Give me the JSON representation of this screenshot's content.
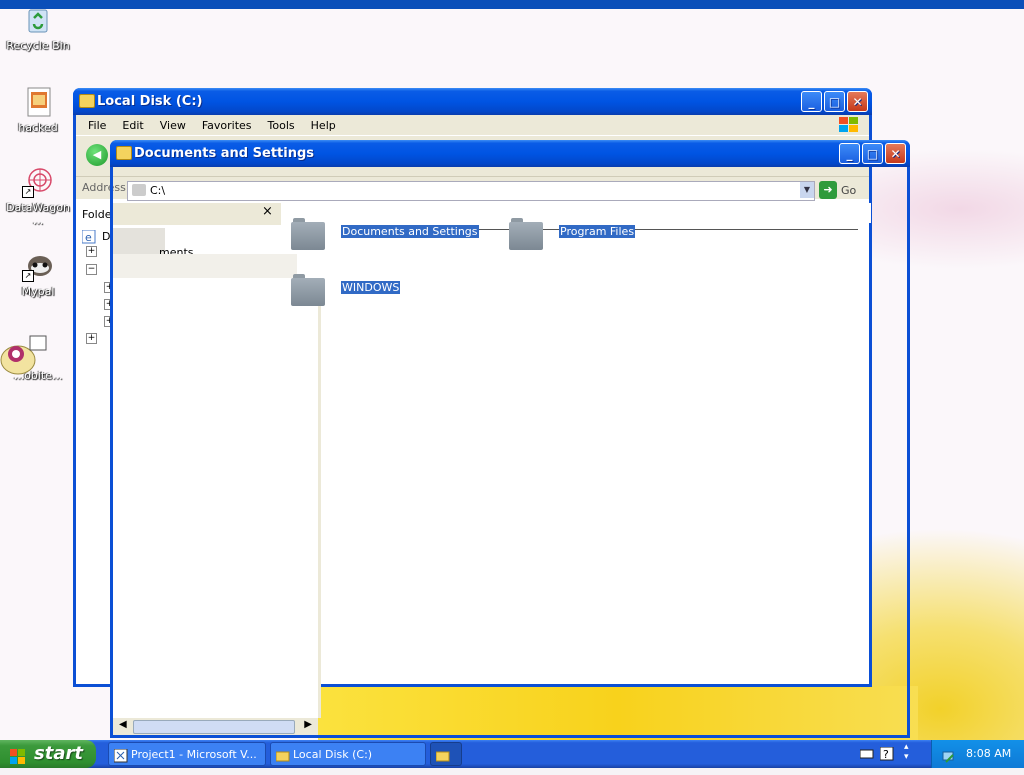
{
  "desktop": {
    "icons": [
      {
        "label": "Recycle Bin",
        "icon": "recycle-bin-icon"
      },
      {
        "label": "hacked",
        "icon": "image-file-icon"
      },
      {
        "label": "DataWagon ...",
        "icon": "datawagon-icon"
      },
      {
        "label": "Mypal",
        "icon": "mypal-raccoon-icon"
      },
      {
        "label": "...obite...",
        "icon": "pet-character-icon"
      }
    ]
  },
  "window_local_disk": {
    "title": "Local Disk (C:)",
    "menu": [
      "File",
      "Edit",
      "View",
      "Favorites",
      "Tools",
      "Help"
    ],
    "address_label": "Address",
    "address_value": "C:\\",
    "go_label": "Go",
    "folders_pane_label": "Folders",
    "tree_fragments": [
      "De",
      "ments"
    ]
  },
  "window_docs": {
    "title": "Documents and Settings",
    "items": [
      {
        "label": "Documents and Settings",
        "icon": "folder-icon"
      },
      {
        "label": "Program Files",
        "icon": "folder-icon"
      },
      {
        "label": "WINDOWS",
        "icon": "folder-icon"
      }
    ],
    "close_pane_glyph": "×"
  },
  "taskbar": {
    "start_label": "start",
    "tasks": [
      {
        "label": "Project1 - Microsoft V...",
        "icon": "visual-basic-icon",
        "state": "normal"
      },
      {
        "label": "Local Disk (C:)",
        "icon": "folder-icon",
        "state": "normal"
      },
      {
        "label": "",
        "icon": "folder-icon",
        "state": "active"
      }
    ],
    "clock": "8:08 AM"
  },
  "colors": {
    "titlebar": "#0054e3",
    "selection": "#316ac5",
    "taskbar": "#245edb",
    "start_button": "#3c9a3c"
  }
}
